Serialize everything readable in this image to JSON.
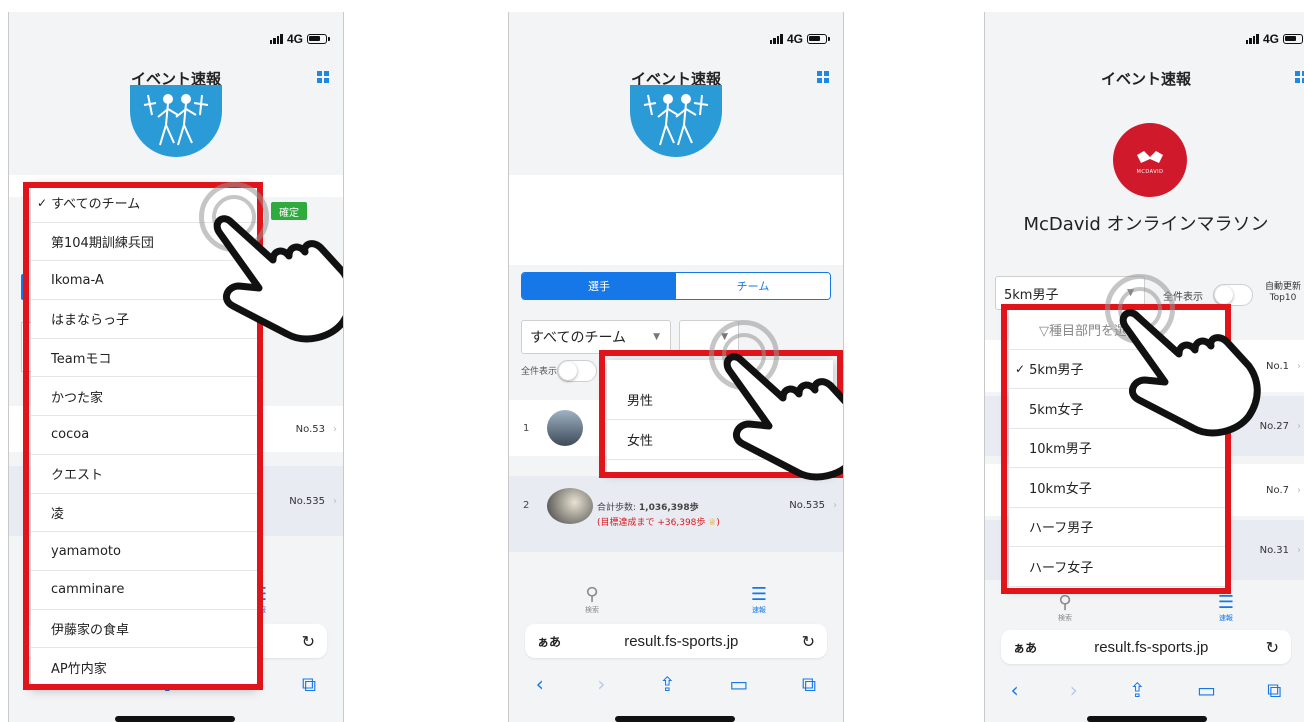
{
  "status": {
    "network": "4G"
  },
  "nav_title": "イベント速報",
  "browser": {
    "aa": "ぁあ",
    "url": "result.fs-sports.jp"
  },
  "tabs": {
    "search": "検索",
    "results": "速報"
  },
  "colors": {
    "highlight": "#e0151b",
    "accent": "#1677e8",
    "confirm": "#2eaa3f",
    "mcdavid_red": "#d0192a"
  },
  "panel1": {
    "confirm_label": "確定",
    "team_options": [
      "すべてのチーム",
      "第104期訓練兵団",
      "Ikoma-A",
      "はまならっ子",
      "Teamモコ",
      "かつた家",
      "cocoa",
      "クエスト",
      "凌",
      "yamamoto",
      "camminare",
      "伊藤家の食卓",
      "AP竹内家"
    ],
    "selected_index": 0,
    "rows": [
      {
        "no": "No.53"
      },
      {
        "no": "No.535"
      }
    ]
  },
  "panel2": {
    "tabs": [
      "選手",
      "チーム"
    ],
    "team_select": "すべてのチーム",
    "show_all": "全件表示",
    "gender_options": [
      "男性",
      "女性"
    ],
    "rows": [
      {
        "rank": "1"
      },
      {
        "rank": "2",
        "steps_label": "合計歩数: ",
        "steps_value": "1,036,398歩",
        "goal_text": "(目標達成まで +36,398歩",
        "goal_close": ")",
        "no": "No.535"
      }
    ]
  },
  "panel3": {
    "event_title": "McDavid オンラインマラソン",
    "brand": "MCDAVID",
    "category_select": "5km男子",
    "show_all": "全件表示",
    "auto_update": "自動更新",
    "top10": "Top10",
    "category_options": [
      "▽種目部門を選択",
      "5km男子",
      "5km女子",
      "10km男子",
      "10km女子",
      "ハーフ男子",
      "ハーフ女子"
    ],
    "selected_index": 1,
    "rows": [
      {
        "no": "No.1"
      },
      {
        "no": "No.27"
      },
      {
        "no": "No.7"
      },
      {
        "no": "No.31"
      }
    ]
  }
}
